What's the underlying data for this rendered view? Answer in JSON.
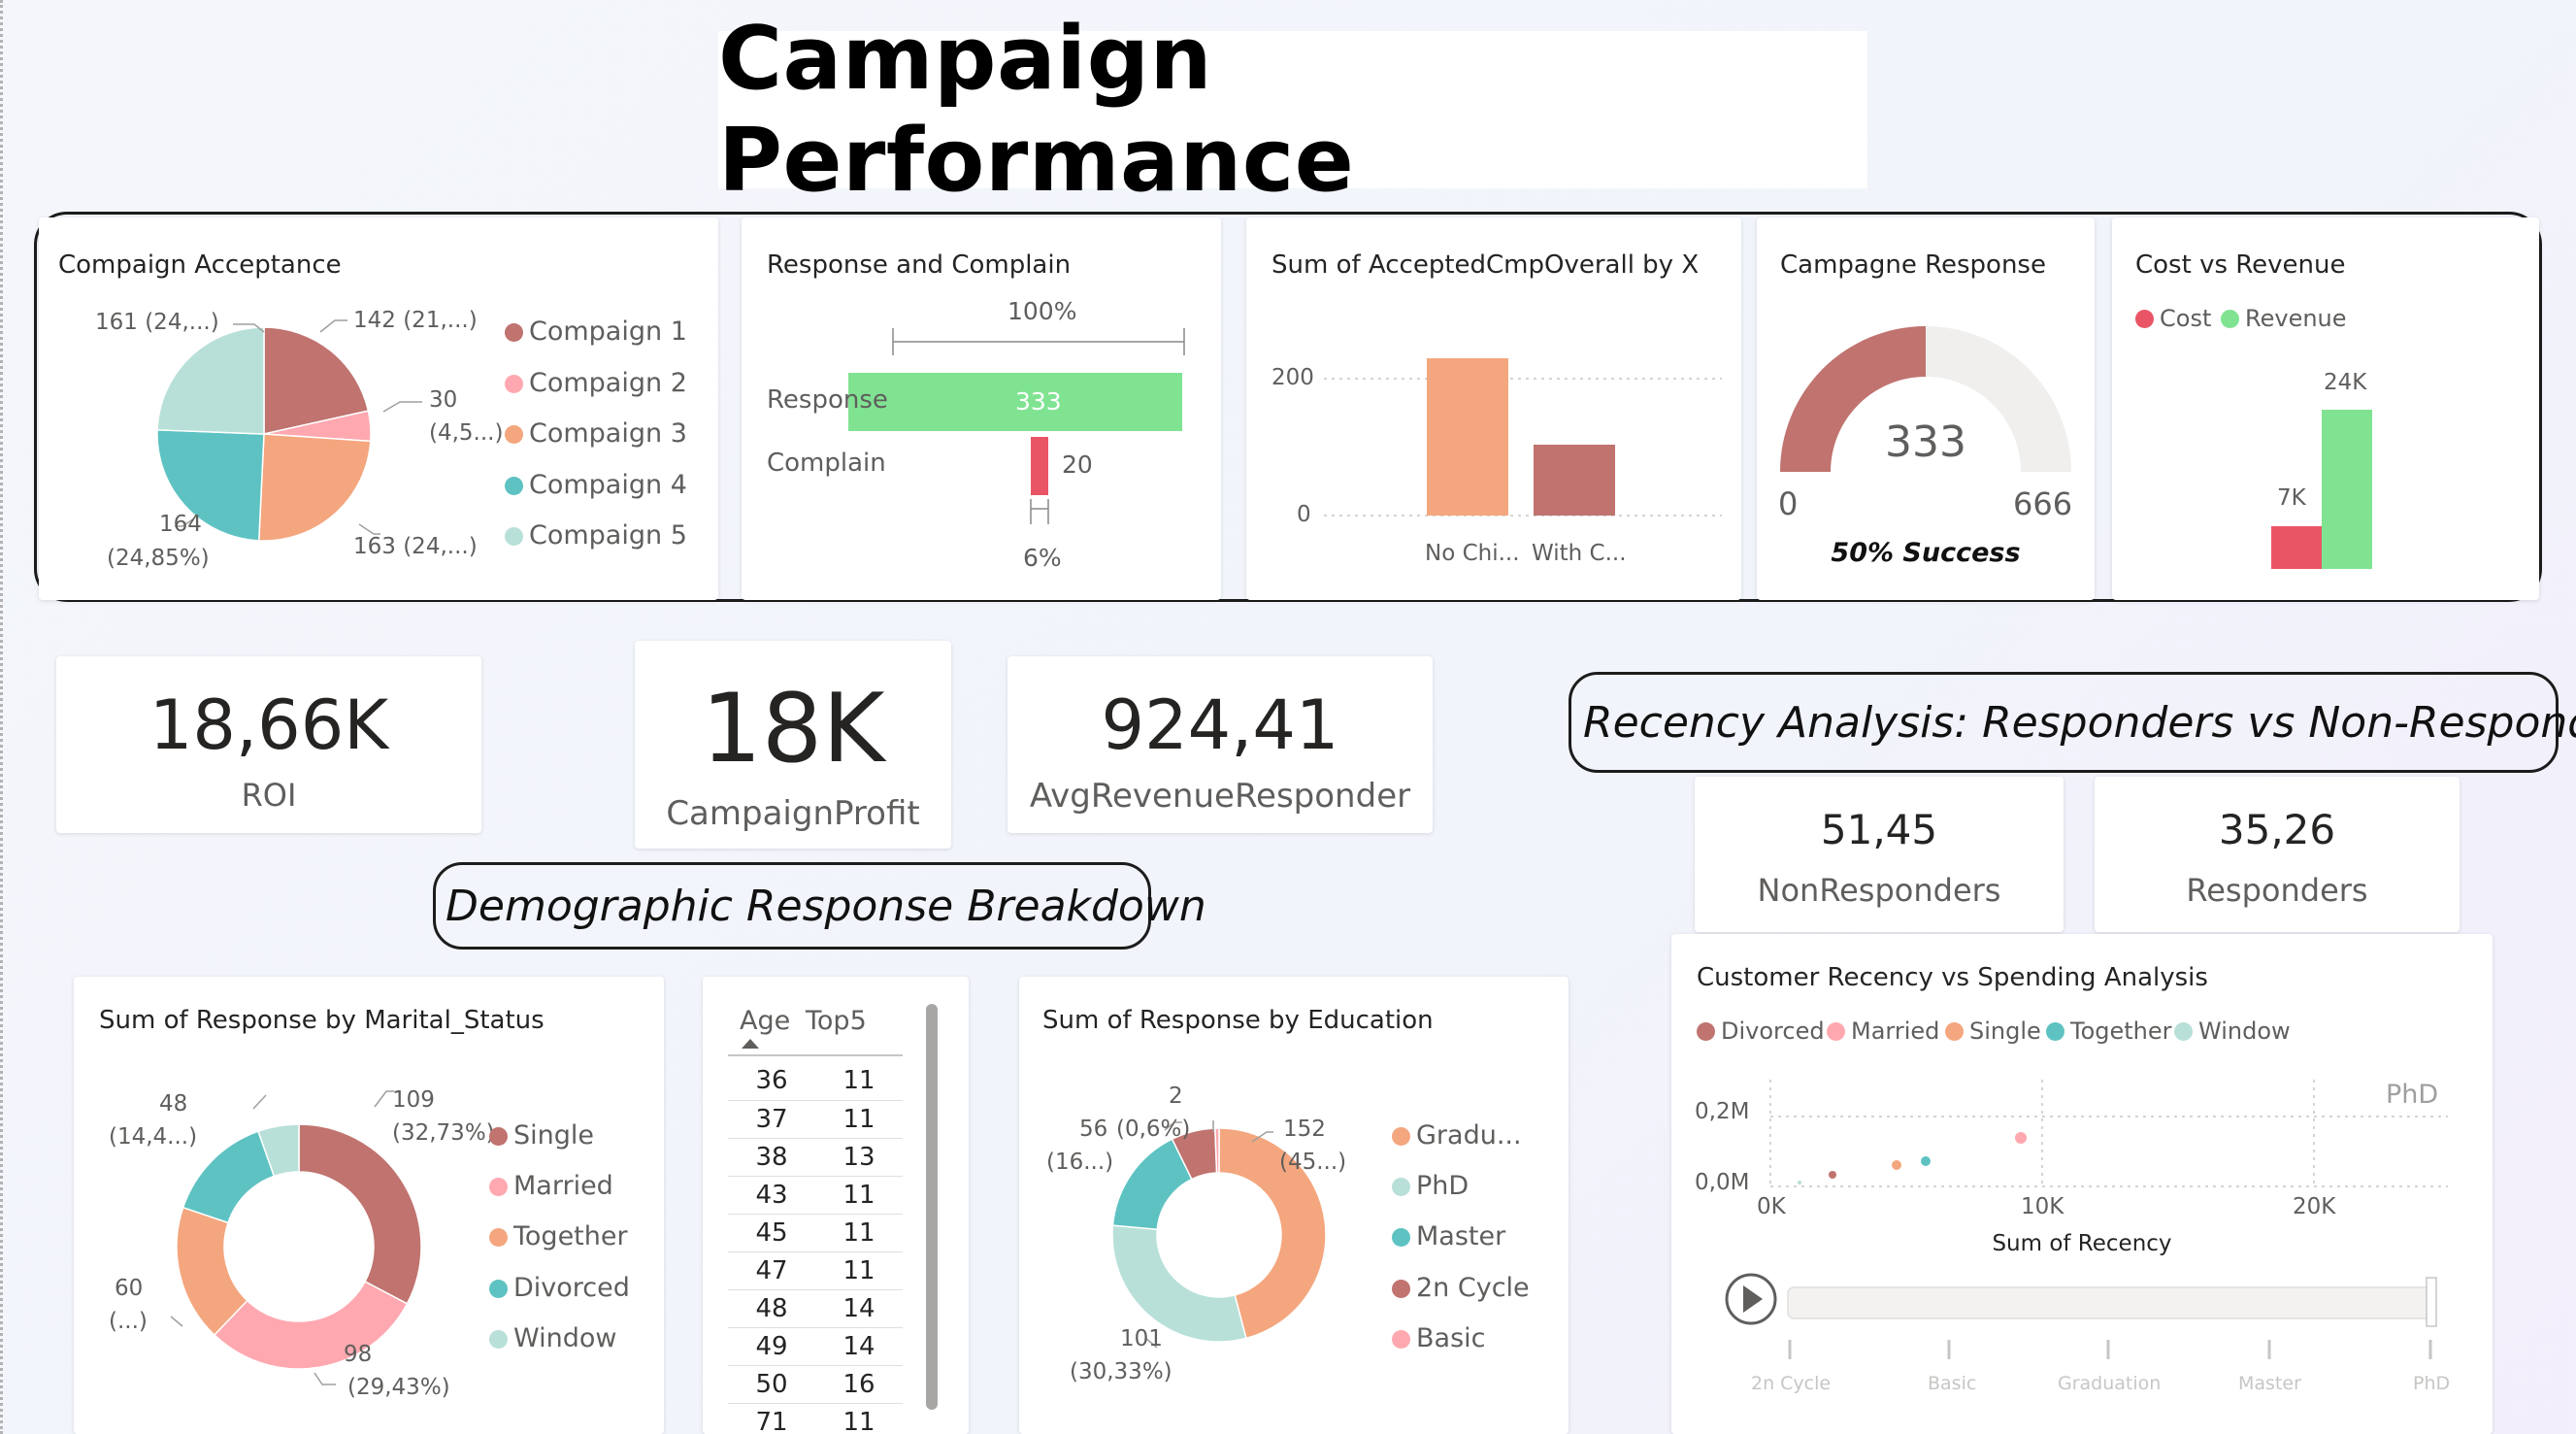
{
  "page_title": "Campaign Performance",
  "colors": {
    "c1": "#c0736f",
    "c2": "#ffa8b0",
    "c3": "#f4a67e",
    "c4": "#5ec2c2",
    "c5": "#b8e0d8",
    "green": "#80e392",
    "red": "#ea5565",
    "gauge_fill": "#c0736f",
    "gauge_bg": "#f0efee"
  },
  "compaign_acceptance": {
    "title": "Compaign Acceptance",
    "labels": {
      "c5": "161 (24,...)",
      "c1": "142 (21,...)",
      "c2a": "30",
      "c2b": "(4,5...)",
      "c4a": "164",
      "c4b": "(24,85%)",
      "c3": "163 (24,...)"
    },
    "legend": [
      "Compaign 1",
      "Compaign 2",
      "Compaign 3",
      "Compaign 4",
      "Compaign 5"
    ]
  },
  "response_complain": {
    "title": "Response and Complain",
    "top_pct": "100%",
    "bottom_pct": "6%",
    "rows": [
      {
        "label": "Response",
        "value": "333"
      },
      {
        "label": "Complain",
        "value": "20"
      }
    ]
  },
  "accepted_by_x": {
    "title": "Sum of AcceptedCmpOverall by X",
    "ticks": [
      "200",
      "0"
    ],
    "categories": [
      "No Chi...",
      "With C..."
    ]
  },
  "campagne_response": {
    "title": "Campagne Response",
    "value": "333",
    "min": "0",
    "max": "666",
    "fraction": 0.5,
    "caption": "50% Success"
  },
  "cost_revenue": {
    "title": "Cost vs Revenue",
    "legend": [
      "Cost",
      "Revenue"
    ],
    "labels": [
      "7K",
      "24K"
    ]
  },
  "kpis": [
    {
      "value": "18,66K",
      "label": "ROI"
    },
    {
      "value": "18K",
      "label": "CampaignProfit"
    },
    {
      "value": "924,41",
      "label": "AvgRevenueResponder"
    }
  ],
  "recency": {
    "section_title": "Recency Analysis: Responders vs Non-Responders",
    "nonresponders": {
      "value": "51,45",
      "label": "NonResponders"
    },
    "responders": {
      "value": "35,26",
      "label": "Responders"
    }
  },
  "demographic_title": "Demographic Response Breakdown",
  "marital": {
    "title": "Sum of Response by Marital_Status",
    "labels": {
      "single_a": "109",
      "single_b": "(32,73%)",
      "married_a": "98",
      "married_b": "(29,43%)",
      "together_a": "60",
      "together_b": "(...)",
      "divorced_a": "48",
      "divorced_b": "(14,4...)"
    },
    "legend": [
      "Single",
      "Married",
      "Together",
      "Divorced",
      "Window"
    ]
  },
  "age_table": {
    "headers": [
      "Age",
      "Top5"
    ],
    "rows": [
      [
        "36",
        "11"
      ],
      [
        "37",
        "11"
      ],
      [
        "38",
        "13"
      ],
      [
        "43",
        "11"
      ],
      [
        "45",
        "11"
      ],
      [
        "47",
        "11"
      ],
      [
        "48",
        "14"
      ],
      [
        "49",
        "14"
      ],
      [
        "50",
        "16"
      ],
      [
        "71",
        "11"
      ]
    ]
  },
  "education": {
    "title": "Sum of Response by Education",
    "labels": {
      "basic": "2",
      "cycle_a": "56",
      "cycle_b": "(0,6%)",
      "master_b": "(16...)",
      "grad_a": "152",
      "grad_b": "(45...)",
      "phd_a": "101",
      "phd_b": "(30,33%)"
    },
    "legend": [
      "Gradu...",
      "PhD",
      "Master",
      "2n Cycle",
      "Basic"
    ]
  },
  "scatter": {
    "title": "Customer Recency vs Spending Analysis",
    "legend": [
      "Divorced",
      "Married",
      "Single",
      "Together",
      "Window"
    ],
    "y_ticks": [
      "0,2M",
      "0,0M"
    ],
    "x_ticks": [
      "0K",
      "10K",
      "20K"
    ],
    "x_title": "Sum of Recency",
    "frame_label": "PhD",
    "play_ticks": [
      "2n Cycle",
      "Basic",
      "Graduation",
      "Master",
      "PhD"
    ]
  }
}
